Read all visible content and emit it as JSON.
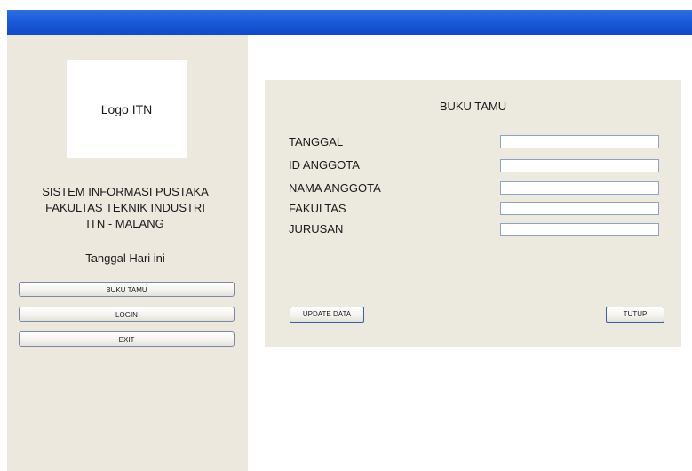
{
  "sidebar": {
    "logo_text": "Logo ITN",
    "app_title_line1": "SISTEM INFORMASI PUSTAKA",
    "app_title_line2": "FAKULTAS TEKNIK INDUSTRI",
    "app_title_line3": "ITN - MALANG",
    "date_label": "Tanggal Hari ini",
    "buttons": {
      "buku_tamu": "BUKU TAMU",
      "login": "LOGIN",
      "exit": "EXIT"
    }
  },
  "form": {
    "title": "BUKU TAMU",
    "fields": {
      "tanggal": {
        "label": "TANGGAL",
        "value": ""
      },
      "id_anggota": {
        "label": "ID ANGGOTA",
        "value": ""
      },
      "nama_anggota": {
        "label": "NAMA ANGGOTA",
        "value": ""
      },
      "fakultas": {
        "label": "FAKULTAS",
        "value": ""
      },
      "jurusan": {
        "label": "JURUSAN",
        "value": ""
      }
    },
    "update_button": "UPDATE DATA",
    "close_button": "TUTUP"
  },
  "colors": {
    "titlebar": "#1b5ad8",
    "sidebar_bg": "#ece8dd",
    "panel_bg": "#ece9df"
  }
}
